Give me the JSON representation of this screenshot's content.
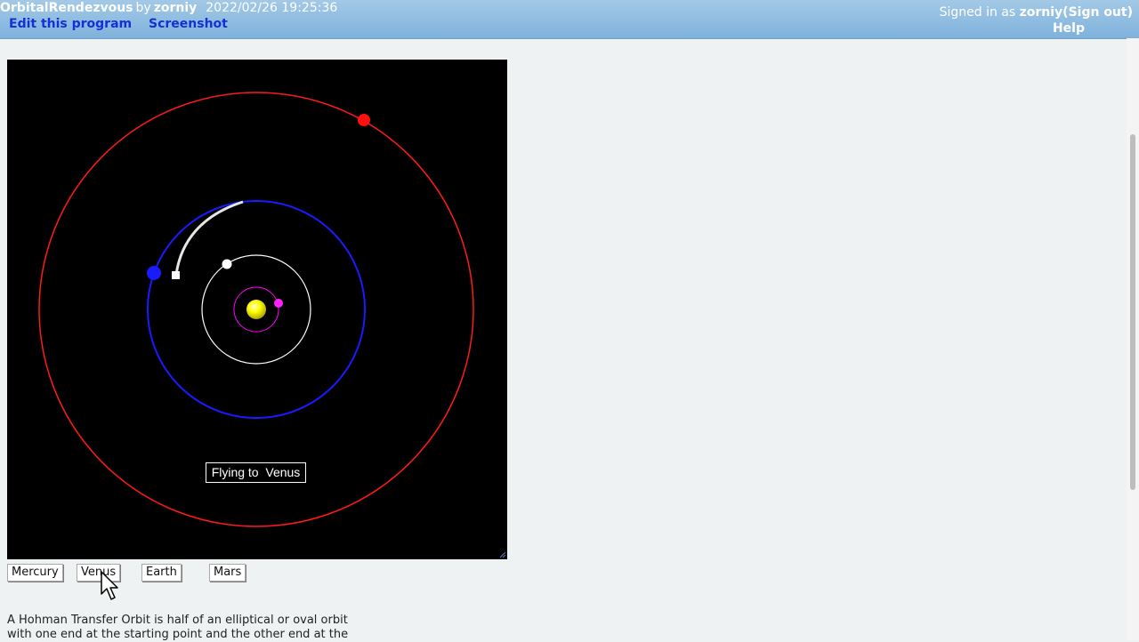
{
  "header": {
    "program_name": "OrbitalRendezvous",
    "by": "by",
    "author": "zorniy",
    "timestamp": "2022/02/26 19:25:36",
    "links": {
      "edit": "Edit this program",
      "screenshot": "Screenshot"
    },
    "signed_in_prefix": "Signed in as",
    "user": "zorniy",
    "sign_out": "(Sign out)",
    "help": "Help"
  },
  "canvas": {
    "status_label": "Flying to  Venus",
    "colors": {
      "background": "#000000",
      "sun": "#ffff00",
      "mercury": "#ff00ff",
      "venus_orbit": "#ffffff",
      "earth": "#0000ff",
      "mars": "#ff0000",
      "transfer_path": "#ffffff"
    }
  },
  "buttons": {
    "mercury": "Mercury",
    "venus": "Venus",
    "earth": "Earth",
    "mars": "Mars"
  },
  "description": {
    "line1": "A Hohman Transfer Orbit is half of an elliptical or oval orbit",
    "line2": "with one end at the starting point and the other end at the"
  }
}
